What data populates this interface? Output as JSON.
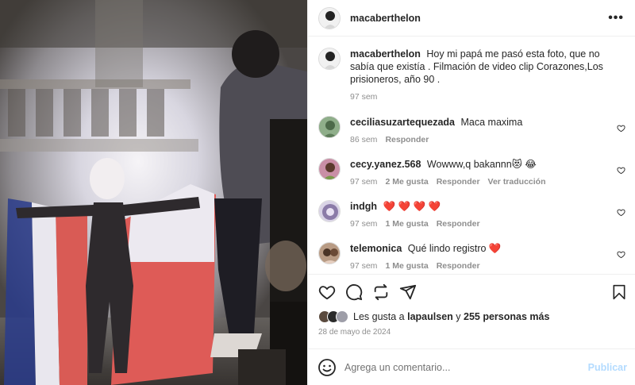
{
  "post": {
    "author": "macaberthelon",
    "more_label": "•••"
  },
  "caption": {
    "username": "macaberthelon",
    "text": "Hoy mi papá me pasó esta foto, que no sabía que existía . Filmación de video clip Corazones,Los prisioneros, año 90 .",
    "time": "97 sem"
  },
  "comments": [
    {
      "username": "ceciliasuzartequezada",
      "text": "Maca maxima",
      "time": "86 sem",
      "likes": "",
      "reply": "Responder",
      "translate": ""
    },
    {
      "username": "cecy.yanez.568",
      "text": "Wowww,q bakannn😻 😂",
      "time": "97 sem",
      "likes": "2 Me gusta",
      "reply": "Responder",
      "translate": "Ver traducción"
    },
    {
      "username": "indgh",
      "text": "❤️ ❤️ ❤️ ❤️",
      "time": "97 sem",
      "likes": "1 Me gusta",
      "reply": "Responder",
      "translate": ""
    },
    {
      "username": "telemonica",
      "text": "Qué lindo registro ❤️",
      "time": "97 sem",
      "likes": "1 Me gusta",
      "reply": "Responder",
      "translate": ""
    }
  ],
  "likes": {
    "prefix": "Les gusta a",
    "user": "lapaulsen",
    "connector": "y",
    "others": "255 personas más"
  },
  "date": "28 de mayo de 2024",
  "add_comment": {
    "placeholder": "Agrega un comentario...",
    "publish_label": "Publicar"
  },
  "icons": {
    "like": "heart-icon",
    "comment": "comment-icon",
    "share": "repost-icon",
    "send": "send-icon",
    "save": "bookmark-icon",
    "emoji": "emoji-icon",
    "more": "more-icon"
  },
  "colors": {
    "text": "#262626",
    "muted": "#8e8e8e",
    "border": "#efefef",
    "publish": "#b3dbff",
    "heart": "#ed4956"
  }
}
